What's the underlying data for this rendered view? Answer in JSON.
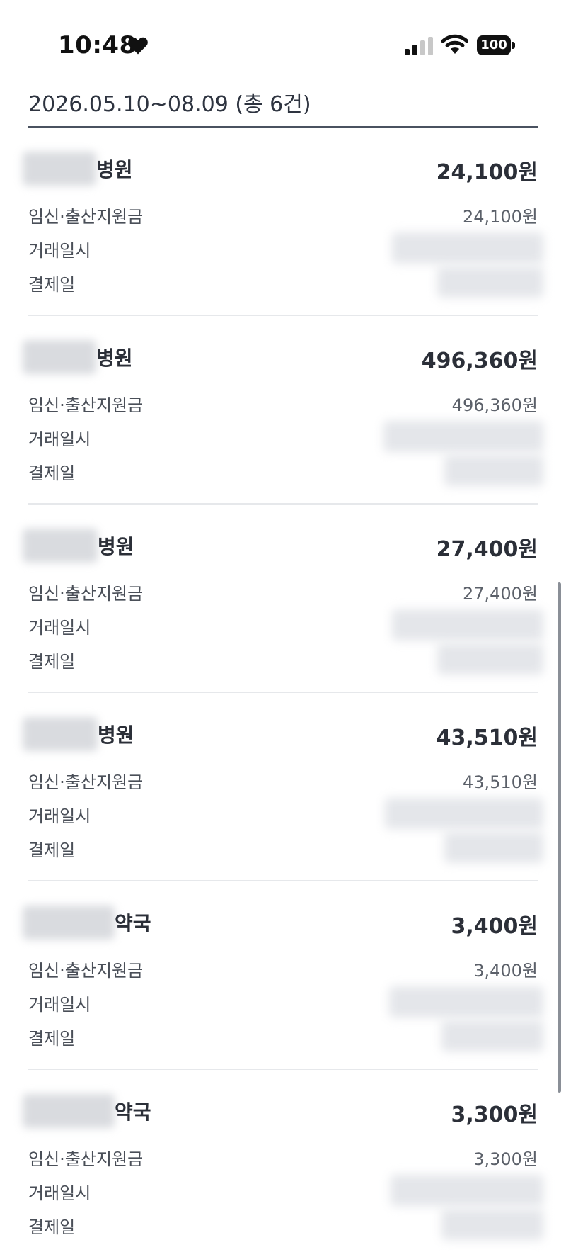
{
  "status_bar": {
    "time": "10:48",
    "battery": "100"
  },
  "summary": {
    "text": "2026.05.10~08.09 (총 6건)"
  },
  "labels": {
    "support": "임신·출산지원금",
    "transaction_time": "거래일시",
    "payment_date": "결제일"
  },
  "records": [
    {
      "merchant_suffix": "병원",
      "amount": "24,100원",
      "support_amount": "24,100원"
    },
    {
      "merchant_suffix": "병원",
      "amount": "496,360원",
      "support_amount": "496,360원"
    },
    {
      "merchant_suffix": "병원",
      "amount": "27,400원",
      "support_amount": "27,400원"
    },
    {
      "merchant_suffix": "병원",
      "amount": "43,510원",
      "support_amount": "43,510원"
    },
    {
      "merchant_suffix": "약국",
      "amount": "3,400원",
      "support_amount": "3,400원"
    },
    {
      "merchant_suffix": "약국",
      "amount": "3,300원",
      "support_amount": "3,300원"
    }
  ]
}
